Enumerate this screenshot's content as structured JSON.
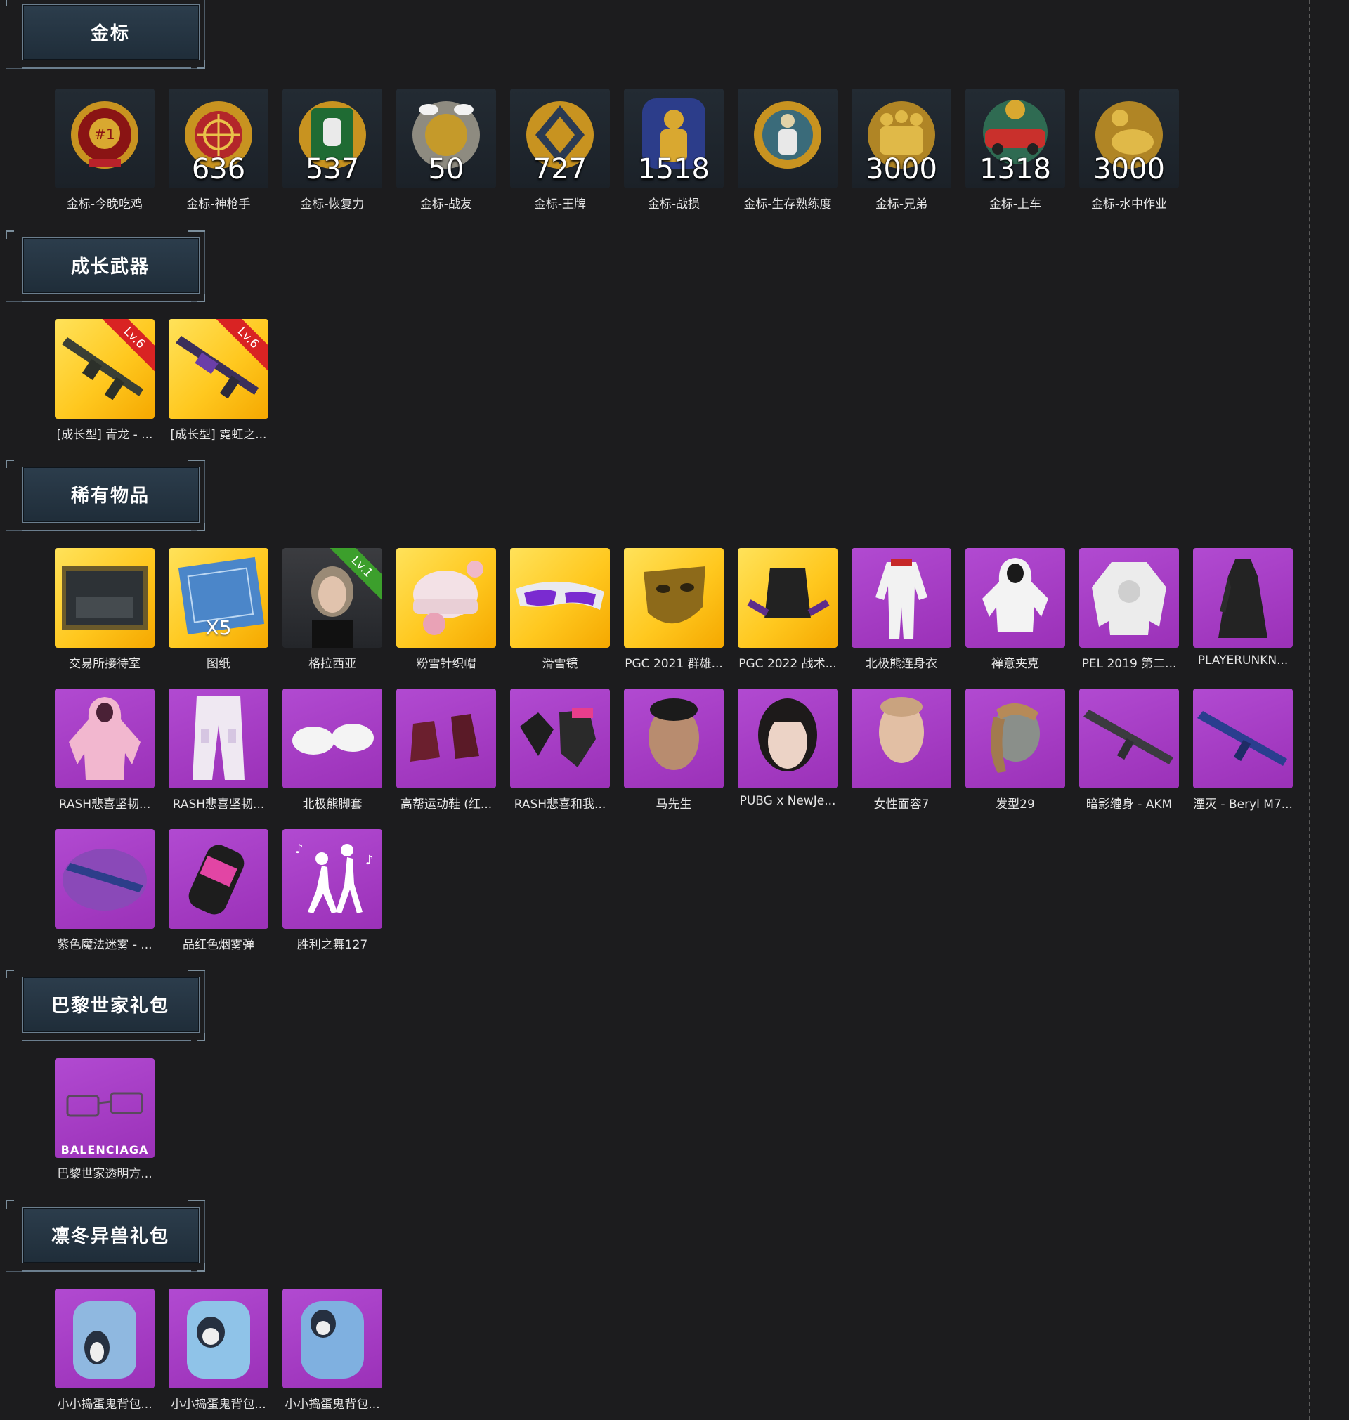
{
  "sections": [
    {
      "title": "金标",
      "items": [
        {
          "label": "金标-今晚吃鸡",
          "count": "",
          "icon": "chicken-dinner-medal-icon"
        },
        {
          "label": "金标-神枪手",
          "count": "636",
          "icon": "crosshair-medal-icon"
        },
        {
          "label": "金标-恢复力",
          "count": "537",
          "icon": "fist-medal-icon"
        },
        {
          "label": "金标-战友",
          "count": "50",
          "icon": "doves-medal-icon"
        },
        {
          "label": "金标-王牌",
          "count": "727",
          "icon": "pistols-medal-icon"
        },
        {
          "label": "金标-战损",
          "count": "1518",
          "icon": "soldier-medal-icon"
        },
        {
          "label": "金标-生存熟练度",
          "count": "",
          "icon": "survivor-medal-icon"
        },
        {
          "label": "金标-兄弟",
          "count": "3000",
          "icon": "squad-medal-icon"
        },
        {
          "label": "金标-上车",
          "count": "1318",
          "icon": "car-medal-icon"
        },
        {
          "label": "金标-水中作业",
          "count": "3000",
          "icon": "seal-medal-icon"
        }
      ]
    },
    {
      "title": "成长武器",
      "items": [
        {
          "label": "[成长型] 青龙 - ...",
          "ribbon": "Lv.6",
          "icon": "rifle-icon"
        },
        {
          "label": "[成长型] 霓虹之...",
          "ribbon": "Lv.6",
          "icon": "neon-rifle-icon"
        }
      ]
    },
    {
      "title": "稀有物品",
      "items": [
        {
          "label": "交易所接待室",
          "bg": "gold",
          "icon": "lobby-room-icon"
        },
        {
          "label": "图纸",
          "bg": "gold",
          "qty": "X5",
          "icon": "blueprint-icon"
        },
        {
          "label": "格拉西亚",
          "bg": "photo",
          "ribbon": "Lv.1",
          "icon": "character-portrait-icon"
        },
        {
          "label": "粉雪针织帽",
          "bg": "gold",
          "icon": "knit-hat-icon"
        },
        {
          "label": "滑雪镜",
          "bg": "gold",
          "icon": "goggles-icon"
        },
        {
          "label": "PGC 2021 群雄...",
          "bg": "gold",
          "icon": "gold-mask-icon"
        },
        {
          "label": "PGC 2022 战术...",
          "bg": "gold",
          "icon": "tactical-vest-icon"
        },
        {
          "label": "北极熊连身衣",
          "bg": "purple",
          "icon": "jumpsuit-icon"
        },
        {
          "label": "禅意夹克",
          "bg": "purple",
          "icon": "hooded-jacket-icon"
        },
        {
          "label": "PEL 2019 第二...",
          "bg": "purple",
          "icon": "bomber-jacket-icon"
        },
        {
          "label": "PLAYERUNKN...",
          "bg": "purple",
          "icon": "trench-coat-icon"
        },
        {
          "label": "RASH悲喜坚韧...",
          "bg": "purple",
          "icon": "pink-hoodie-icon"
        },
        {
          "label": "RASH悲喜坚韧...",
          "bg": "purple",
          "icon": "cargo-pants-icon"
        },
        {
          "label": "北极熊脚套",
          "bg": "purple",
          "icon": "paw-slippers-icon"
        },
        {
          "label": "高帮运动鞋 (红...",
          "bg": "purple",
          "icon": "sneakers-icon"
        },
        {
          "label": "RASH悲喜和我...",
          "bg": "purple",
          "icon": "gloves-icon"
        },
        {
          "label": "马先生",
          "bg": "purple",
          "icon": "male-face-icon"
        },
        {
          "label": "PUBG x NewJe...",
          "bg": "purple",
          "icon": "female-face-icon"
        },
        {
          "label": "女性面容7",
          "bg": "purple",
          "icon": "female-face-icon"
        },
        {
          "label": "发型29",
          "bg": "purple",
          "icon": "ponytail-hair-icon"
        },
        {
          "label": "暗影缠身 - AKM",
          "bg": "purple",
          "icon": "akm-rifle-icon"
        },
        {
          "label": "湮灭 - Beryl M7...",
          "bg": "purple",
          "icon": "beryl-rifle-icon"
        },
        {
          "label": "紫色魔法迷雾 - ...",
          "bg": "purple",
          "icon": "magic-gun-icon"
        },
        {
          "label": "品红色烟雾弹",
          "bg": "purple",
          "icon": "smoke-grenade-icon"
        },
        {
          "label": "胜利之舞127",
          "bg": "purple",
          "icon": "dance-emote-icon"
        }
      ]
    },
    {
      "title": "巴黎世家礼包",
      "items": [
        {
          "label": "巴黎世家透明方...",
          "bg": "purple",
          "brand": "BALENCIAGA",
          "icon": "sunglasses-icon"
        }
      ]
    },
    {
      "title": "凛冬异兽礼包",
      "items": [
        {
          "label": "小小捣蛋鬼背包...",
          "bg": "purple",
          "icon": "penguin-backpack-icon"
        },
        {
          "label": "小小捣蛋鬼背包...",
          "bg": "purple",
          "icon": "penguin-backpack-icon"
        },
        {
          "label": "小小捣蛋鬼背包...",
          "bg": "purple",
          "icon": "penguin-backpack-icon"
        }
      ]
    }
  ],
  "colors": {
    "background": "#1c1c1e",
    "tile_gold": "#ffc81f",
    "tile_purple": "#a23cc2",
    "ribbon_red": "#d92323",
    "ribbon_green": "#3c9f2c"
  }
}
